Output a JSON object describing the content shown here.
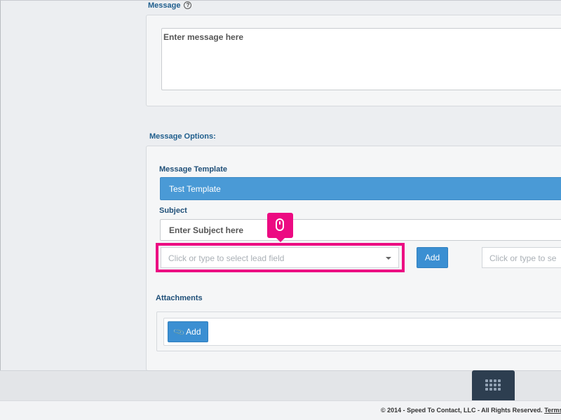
{
  "message_section": {
    "title": "Message",
    "help_icon": "question-circle-icon",
    "placeholder": "Enter message here"
  },
  "options_section": {
    "title": "Message Options:",
    "template": {
      "label": "Message Template",
      "selected": "Test Template"
    },
    "subject": {
      "label": "Subject",
      "placeholder": "Enter Subject here"
    },
    "lead_field": {
      "placeholder": "Click or type to select lead field",
      "add_label": "Add",
      "second_placeholder": "Click or type to se"
    },
    "tooltip_icon": "mouse-icon"
  },
  "attachments": {
    "label": "Attachments",
    "add_label": "Add",
    "icon": "paperclip-icon"
  },
  "dock": {
    "icon": "grid-icon"
  },
  "footer": {
    "text": "© 2014 - Speed To Contact, LLC - All Rights Reserved.",
    "link": "Terms"
  },
  "colors": {
    "accent": "#3b8fd2",
    "label_blue": "#1f5e8d",
    "highlight": "#ec0b82",
    "dock": "#2d3e50"
  }
}
